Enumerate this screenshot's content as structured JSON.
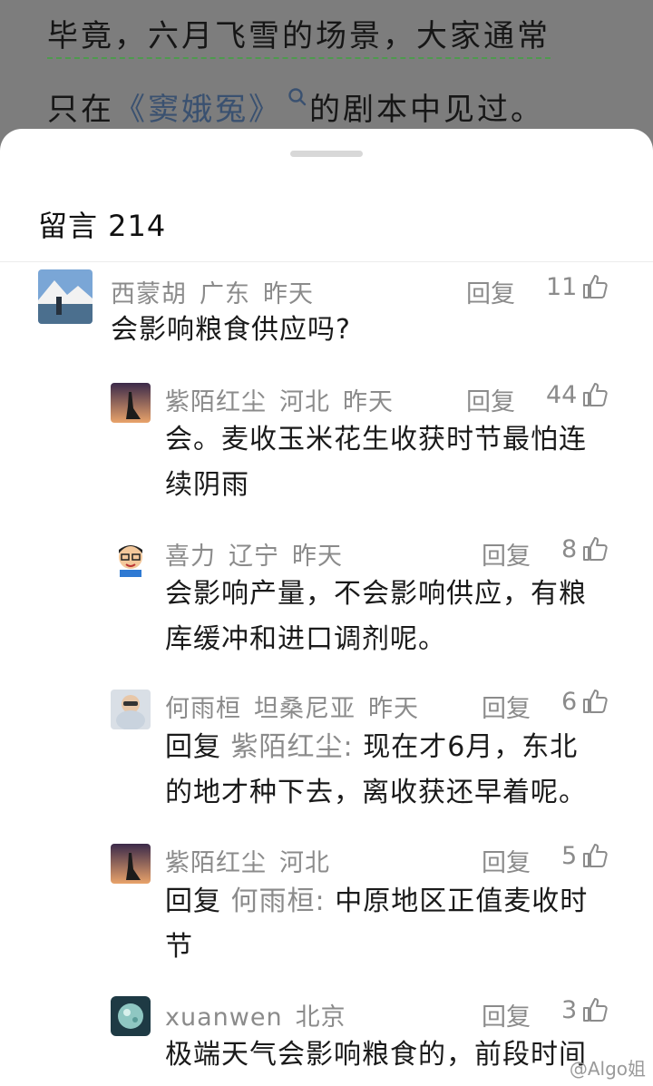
{
  "article": {
    "line1": "毕竟，六月飞雪的场景，大家通常",
    "line2_pre": "只在",
    "line2_link": "《窦娥冤》",
    "line2_post": "的剧本中见过。"
  },
  "sheet": {
    "title": "留言 214"
  },
  "comments": [
    {
      "name": "西蒙胡",
      "region": "广东",
      "time": "昨天",
      "reply": "回复",
      "likes": "11",
      "text": "会影响粮食供应吗?"
    },
    {
      "name": "紫陌红尘",
      "region": "河北",
      "time": "昨天",
      "reply": "回复",
      "likes": "44",
      "text_l1": "会。麦收玉米花生收获时节最怕连",
      "text_l2": "续阴雨"
    },
    {
      "name": "喜力",
      "region": "辽宁",
      "time": "昨天",
      "reply": "回复",
      "likes": "8",
      "text_l1": "会影响产量，不会影响供应，有粮",
      "text_l2": "库缓冲和进口调剂呢。"
    },
    {
      "name": "何雨桓",
      "region": "坦桑尼亚",
      "time": "昨天",
      "reply": "回复",
      "likes": "6",
      "prefix": "回复",
      "mention": "紫陌红尘:",
      "text_l1": "现在才6月，东北",
      "text_l2": "的地才种下去，离收获还早着呢。"
    },
    {
      "name": "紫陌红尘",
      "region": "河北",
      "time": "",
      "reply": "回复",
      "likes": "5",
      "prefix": "回复",
      "mention": "何雨桓:",
      "text_l1": "中原地区正值麦收时",
      "text_l2": "节"
    },
    {
      "name": "xuanwen",
      "region": "北京",
      "time": "",
      "reply": "回复",
      "likes": "3",
      "text": "极端天气会影响粮食的，前段时间"
    }
  ],
  "watermark": "@Algo姐",
  "icons": {
    "like": "thumbs-up-icon",
    "search": "search-icon"
  }
}
